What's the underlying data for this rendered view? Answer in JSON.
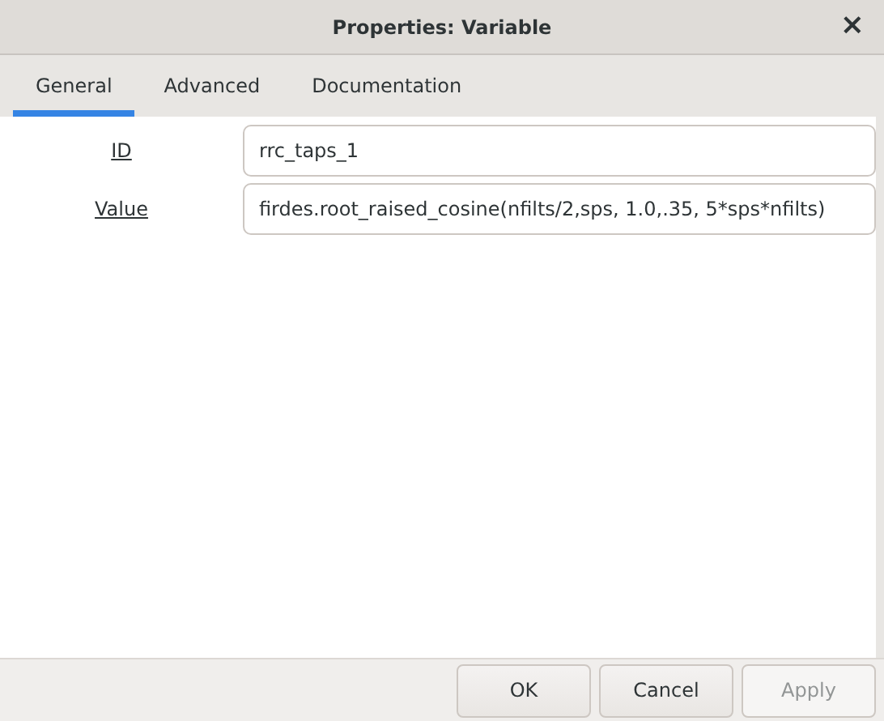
{
  "window": {
    "title": "Properties: Variable",
    "close": "×"
  },
  "tabs": [
    {
      "label": "General",
      "selected": true
    },
    {
      "label": "Advanced",
      "selected": false
    },
    {
      "label": "Documentation",
      "selected": false
    }
  ],
  "fields": [
    {
      "label": "ID",
      "value": "rrc_taps_1"
    },
    {
      "label": "Value",
      "value": "firdes.root_raised_cosine(nfilts/2,sps, 1.0,.35, 5*sps*nfilts)"
    }
  ],
  "buttons": [
    {
      "label": "OK",
      "disabled": false
    },
    {
      "label": "Cancel",
      "disabled": false
    },
    {
      "label": "Apply",
      "disabled": true
    }
  ]
}
